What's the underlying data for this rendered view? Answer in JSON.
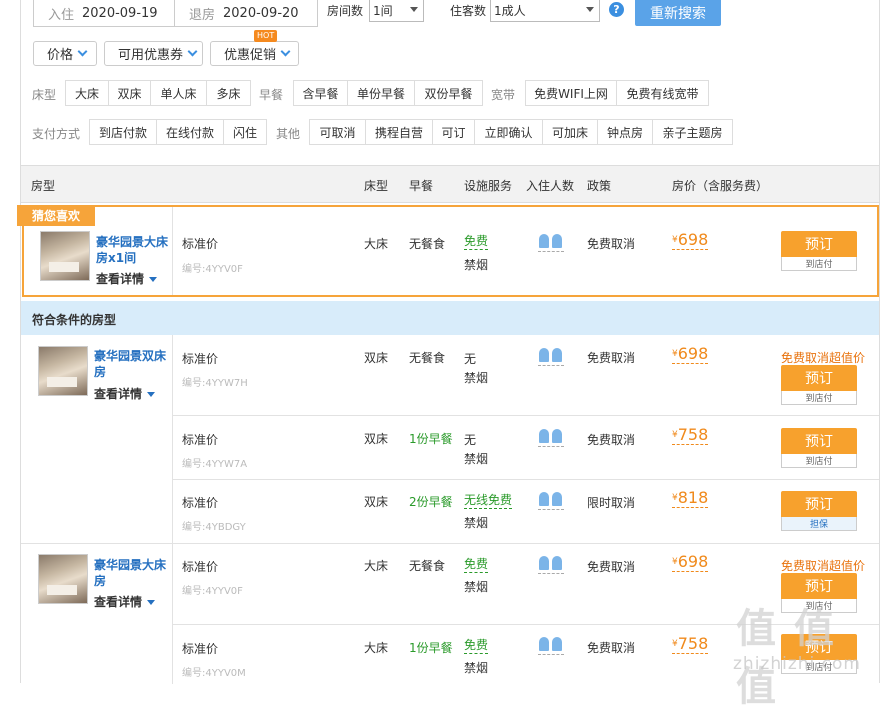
{
  "search": {
    "checkin_label": "入住",
    "checkin_value": "2020-09-19",
    "checkout_label": "退房",
    "checkout_value": "2020-09-20",
    "rooms_label": "房间数",
    "rooms_value": "1间",
    "guests_label": "住客数",
    "guests_value": "1成人",
    "help": "?",
    "search_button": "重新搜索"
  },
  "filters": {
    "dropdowns": [
      "价格",
      "可用优惠券",
      "优惠促销"
    ],
    "hot_badge": "HOT",
    "bed_label": "床型",
    "bed_options": [
      "大床",
      "双床",
      "单人床",
      "多床"
    ],
    "breakfast_label": "早餐",
    "breakfast_options": [
      "含早餐",
      "单份早餐",
      "双份早餐"
    ],
    "broadband_label": "宽带",
    "broadband_options": [
      "免费WIFI上网",
      "免费有线宽带"
    ],
    "payment_label": "支付方式",
    "payment_options": [
      "到店付款",
      "在线付款",
      "闪住"
    ],
    "other_label": "其他",
    "other_options": [
      "可取消",
      "携程自营",
      "可订",
      "立即确认",
      "可加床",
      "钟点房",
      "亲子主题房"
    ]
  },
  "table": {
    "headers": [
      "房型",
      "床型",
      "早餐",
      "设施服务",
      "入住人数",
      "政策",
      "房价（含服务费）"
    ],
    "featured_tag": "猜您喜欢",
    "section_title": "符合条件的房型",
    "detail_label": "查看详情",
    "rate_label": "标准价",
    "currency": "¥",
    "book_label": "预订",
    "featured": {
      "room_name_l1": "豪华园景大床",
      "room_name_l2": "房x1间",
      "code": "编号:4YYV0F",
      "bed": "大床",
      "breakfast": "无餐食",
      "facility": "免费",
      "facility2": "禁烟",
      "policy": "免费取消",
      "price": "698",
      "pay": "到店付"
    },
    "groups": [
      {
        "room_name_l1": "豪华园景双床",
        "room_name_l2": "房",
        "rates": [
          {
            "code": "编号:4YYW7H",
            "bed": "双床",
            "breakfast": "无餐食",
            "facility": "无",
            "facility2": "禁烟",
            "policy": "免费取消",
            "price": "698",
            "promo": "免费取消超值价",
            "pay": "到店付"
          },
          {
            "code": "编号:4YYW7A",
            "bed": "双床",
            "breakfast": "1份早餐",
            "facility": "无",
            "facility2": "禁烟",
            "policy": "免费取消",
            "price": "758",
            "pay": "到店付"
          },
          {
            "code": "编号:4YBDGY",
            "bed": "双床",
            "breakfast": "2份早餐",
            "facility": "无线免费",
            "facility2": "禁烟",
            "policy": "限时取消",
            "price": "818",
            "pay": "担保"
          }
        ]
      },
      {
        "room_name_l1": "豪华园景大床",
        "room_name_l2": "房",
        "rates": [
          {
            "code": "编号:4YYV0F",
            "bed": "大床",
            "breakfast": "无餐食",
            "facility": "免费",
            "facility2": "禁烟",
            "policy": "免费取消",
            "price": "698",
            "promo": "免费取消超值价",
            "pay": "到店付"
          },
          {
            "code": "编号:4YYV0M",
            "bed": "大床",
            "breakfast": "1份早餐",
            "facility": "免费",
            "facility2": "禁烟",
            "policy": "免费取消",
            "price": "758",
            "pay": "到店付"
          }
        ]
      }
    ]
  },
  "watermark": {
    "logo": "值 值 值",
    "domain": "zhizhizhi.com"
  }
}
